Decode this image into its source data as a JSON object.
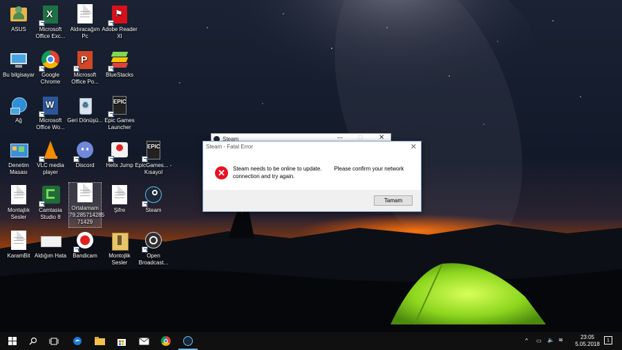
{
  "desktop": {
    "icons": [
      {
        "label": "ASUS"
      },
      {
        "label": "Microsoft Office Exc..."
      },
      {
        "label": "Aldıracağım Pc"
      },
      {
        "label": "Adobe Reader XI"
      },
      {
        "label": "Bu bilgisayar"
      },
      {
        "label": "Google Chrome"
      },
      {
        "label": "Microsoft Office Po..."
      },
      {
        "label": "BlueStacks"
      },
      {
        "label": "Ağ"
      },
      {
        "label": "Microsoft Office Wo..."
      },
      {
        "label": "Geri Dönüşü..."
      },
      {
        "label": "Epic Games Launcher"
      },
      {
        "label": "Denetim Masası"
      },
      {
        "label": "VLC media player"
      },
      {
        "label": "Discord"
      },
      {
        "label": "Helix Jump"
      },
      {
        "label": "EpicGames... - Kısayol"
      },
      {
        "label": "Montajlık Sesler"
      },
      {
        "label": "Camtasia Studio 8"
      },
      {
        "label": "Ortalamam 79,285714285 71429"
      },
      {
        "label": "Şifre"
      },
      {
        "label": "Steam"
      },
      {
        "label": "KaramBit"
      },
      {
        "label": "Aldığım Hata"
      },
      {
        "label": "Bandicam"
      },
      {
        "label": "Montojlik Sesler"
      },
      {
        "label": "Open Broadcast..."
      }
    ]
  },
  "steam_window": {
    "title": "Steam"
  },
  "dialog": {
    "title": "Steam - Fatal Error",
    "message": "Steam needs to be online to update.        Please confirm your network\nconnection and try again.",
    "button": "Tamam"
  },
  "taskbar": {
    "time": "23:05",
    "date": "5.05.2018",
    "notification_count": "1"
  },
  "colors": {
    "accent": "#76b9ed",
    "error": "#e81123",
    "taskbar": "#101010"
  }
}
